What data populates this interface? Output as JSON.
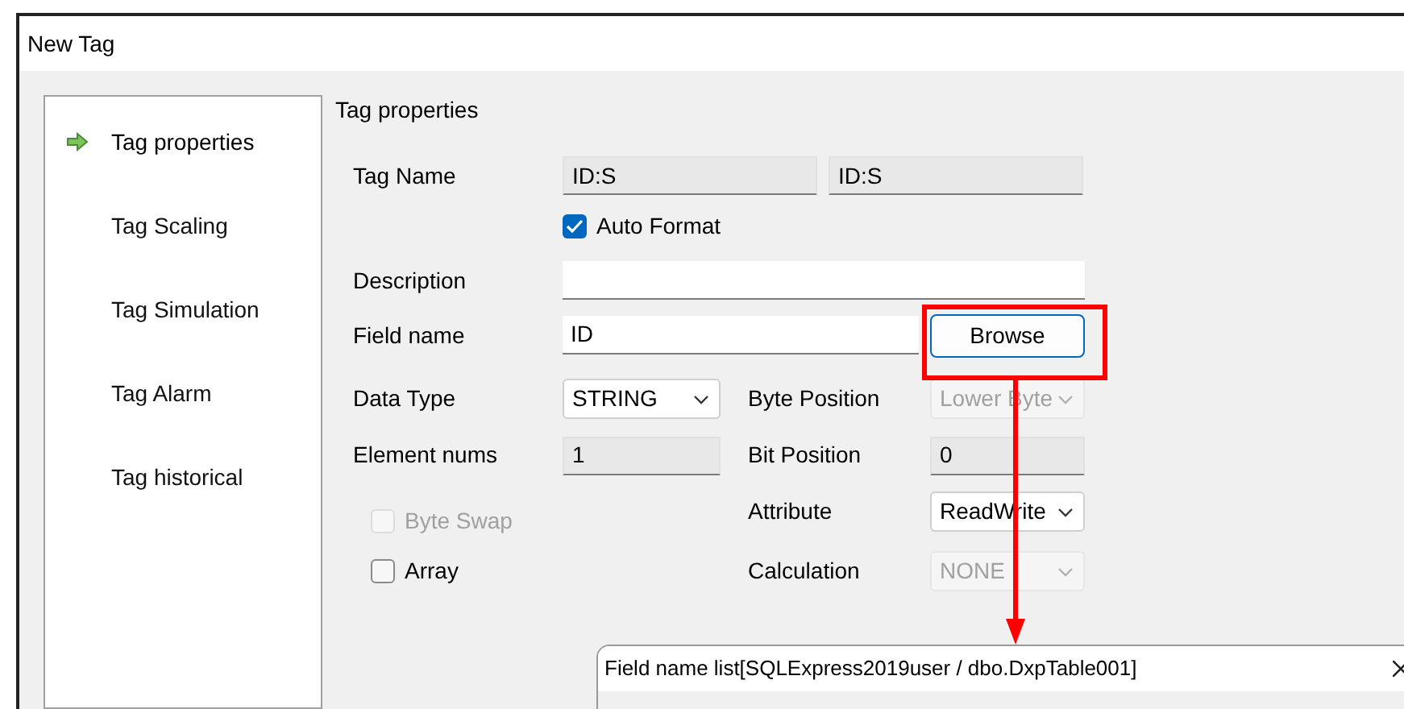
{
  "window": {
    "title": "New Tag"
  },
  "sidebar": {
    "items": [
      {
        "label": "Tag properties",
        "selected": true
      },
      {
        "label": "Tag Scaling",
        "selected": false
      },
      {
        "label": "Tag Simulation",
        "selected": false
      },
      {
        "label": "Tag Alarm",
        "selected": false
      },
      {
        "label": "Tag historical",
        "selected": false
      }
    ]
  },
  "section_title": "Tag properties",
  "tag_name": {
    "label": "Tag Name",
    "values": [
      "ID:S",
      "ID:S"
    ],
    "readonly": true
  },
  "auto_format": {
    "label": "Auto Format",
    "checked": true
  },
  "description": {
    "label": "Description",
    "readonly": false
  },
  "field_name": {
    "label": "Field name",
    "value": "ID",
    "readonly": false,
    "button": "Browse"
  },
  "data_type": {
    "label": "Data Type",
    "value": "STRING",
    "disabled": false
  },
  "element_nums": {
    "label": "Element nums",
    "value": "1",
    "readonly": true
  },
  "byte_swap": {
    "label": "Byte Swap",
    "checked": false,
    "disabled": true
  },
  "array": {
    "label": "Array",
    "checked": false,
    "disabled": false
  },
  "byte_position": {
    "label": "Byte Position",
    "value": "Lower Byte",
    "disabled": true
  },
  "bit_position": {
    "label": "Bit Position",
    "value": "0",
    "readonly": true
  },
  "attribute": {
    "label": "Attribute",
    "value": "ReadWrite",
    "disabled": false
  },
  "calculation": {
    "label": "Calculation",
    "value": "NONE",
    "disabled": true
  },
  "field_list_dialog": {
    "title": "Field name list[SQLExpress2019user / dbo.DxpTable001]"
  }
}
